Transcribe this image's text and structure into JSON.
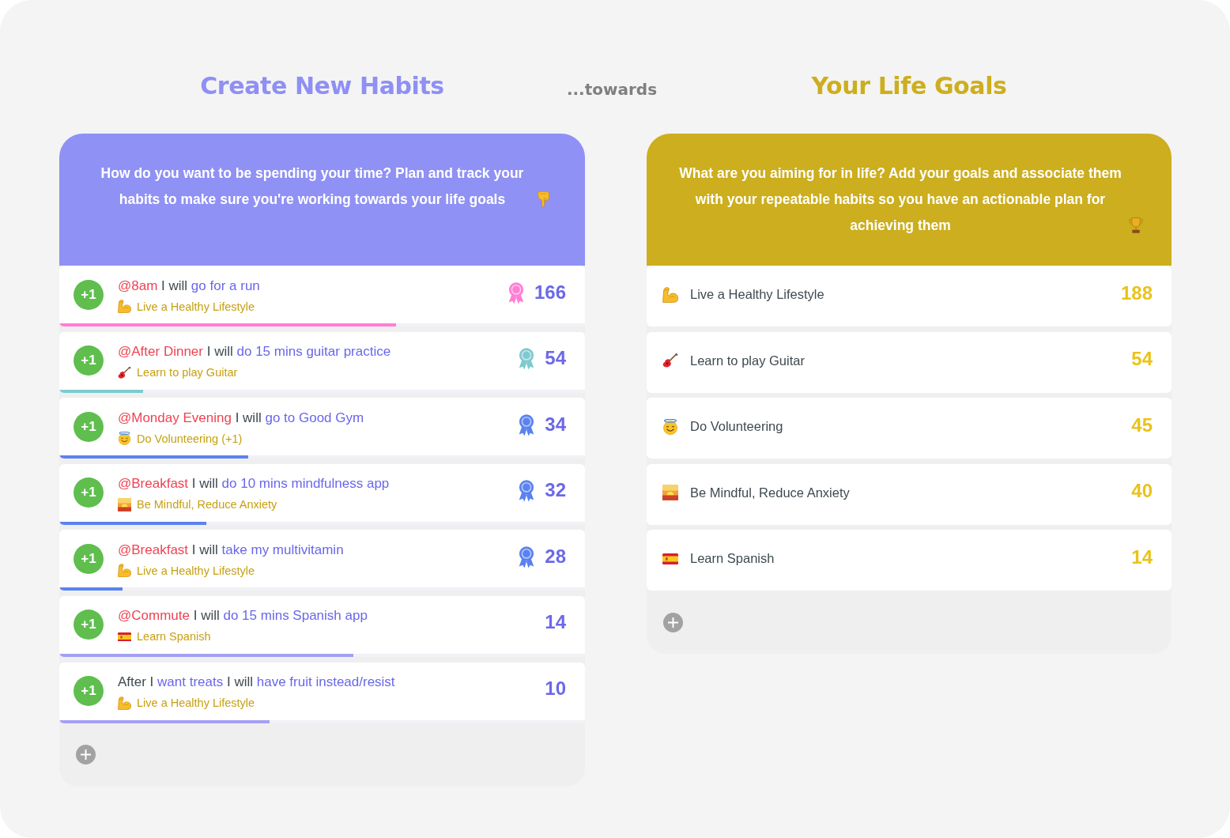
{
  "headings": {
    "habits": "Create New Habits",
    "connector": "...towards",
    "goals": "Your Life Goals"
  },
  "habits_panel": {
    "description": "How do you want to be spending your time? Plan and track your habits to make sure you're working towards your life goals",
    "habits": [
      {
        "button": "+1",
        "sentence": [
          {
            "kind": "when",
            "text": "@8am"
          },
          {
            "kind": "plain",
            "text": "I will"
          },
          {
            "kind": "what",
            "text": "go for a run"
          }
        ],
        "goal": {
          "kind": "fitness",
          "label": "Live a Healthy Lifestyle"
        },
        "award": true,
        "color": "#ff7fd4",
        "level": 0.64,
        "count": "166"
      },
      {
        "button": "+1",
        "sentence": [
          {
            "kind": "when",
            "text": "@After Dinner"
          },
          {
            "kind": "plain",
            "text": "I will"
          },
          {
            "kind": "what",
            "text": "do 15 mins guitar practice"
          }
        ],
        "goal": {
          "kind": "music",
          "label": "Learn to play Guitar"
        },
        "award": true,
        "color": "#7fcad0",
        "level": 0.16,
        "count": "54"
      },
      {
        "button": "+1",
        "sentence": [
          {
            "kind": "when",
            "text": "@Monday Evening"
          },
          {
            "kind": "plain",
            "text": "I will"
          },
          {
            "kind": "what",
            "text": "go to Good Gym"
          }
        ],
        "goal": {
          "kind": "volunteering",
          "label": "Do Volunteering (+1)"
        },
        "award": true,
        "color": "#5b82ef",
        "level": 0.36,
        "count": "34"
      },
      {
        "button": "+1",
        "sentence": [
          {
            "kind": "when",
            "text": "@Breakfast"
          },
          {
            "kind": "plain",
            "text": "I will"
          },
          {
            "kind": "what",
            "text": "do 10 mins mindfulness app"
          }
        ],
        "goal": {
          "kind": "mindfulness",
          "label": "Be Mindful, Reduce Anxiety"
        },
        "award": true,
        "color": "#5b82ef",
        "level": 0.28,
        "count": "32"
      },
      {
        "button": "+1",
        "sentence": [
          {
            "kind": "when",
            "text": "@Breakfast"
          },
          {
            "kind": "plain",
            "text": "I will"
          },
          {
            "kind": "what",
            "text": "take my multivitamin"
          }
        ],
        "goal": {
          "kind": "fitness",
          "label": "Live a Healthy Lifestyle"
        },
        "award": true,
        "color": "#5b82ef",
        "level": 0.12,
        "count": "28"
      },
      {
        "button": "+1",
        "sentence": [
          {
            "kind": "when",
            "text": "@Commute"
          },
          {
            "kind": "plain",
            "text": "I will"
          },
          {
            "kind": "what",
            "text": "do 15 mins Spanish app"
          }
        ],
        "goal": {
          "kind": "language",
          "label": "Learn Spanish"
        },
        "award": false,
        "color": "#a59ff3",
        "level": 0.56,
        "count": "14"
      },
      {
        "button": "+1",
        "sentence": [
          {
            "kind": "plain",
            "text": "After I"
          },
          {
            "kind": "what",
            "text": "want treats"
          },
          {
            "kind": "plain",
            "text": "I will"
          },
          {
            "kind": "what",
            "text": "have fruit instead/resist"
          }
        ],
        "goal": {
          "kind": "fitness",
          "label": "Live a Healthy Lifestyle"
        },
        "award": false,
        "color": "#a59ff3",
        "level": 0.4,
        "count": "10"
      }
    ]
  },
  "goals_panel": {
    "description": "What are you aiming for in life? Add your goals and associate them with your repeatable habits so you have an actionable plan for achieving them",
    "goals": [
      {
        "kind": "fitness",
        "label": "Live a Healthy Lifestyle",
        "count": "188"
      },
      {
        "kind": "music",
        "label": "Learn to play Guitar",
        "count": "54"
      },
      {
        "kind": "volunteering",
        "label": "Do Volunteering",
        "count": "45"
      },
      {
        "kind": "mindfulness",
        "label": "Be Mindful, Reduce Anxiety",
        "count": "40"
      },
      {
        "kind": "language",
        "label": "Learn Spanish",
        "count": "14"
      }
    ]
  }
}
